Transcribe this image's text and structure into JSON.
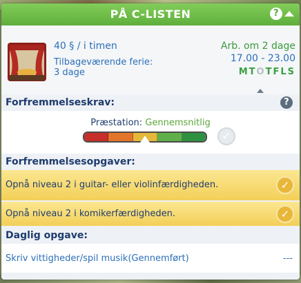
{
  "header": {
    "title": "PÅ C-LISTEN",
    "help_label": "?"
  },
  "job": {
    "icon": "stage-curtain-icon",
    "salary_amount": "40",
    "currency_symbol": "§",
    "salary_unit": "/ i timen",
    "vacation_label": "Tilbageværende ferie:",
    "vacation_value": "3 dage",
    "next_work": "Arb. om 2 dage",
    "hours": "17.00 - 23.00",
    "days": [
      {
        "letter": "M",
        "active": true
      },
      {
        "letter": "T",
        "active": true
      },
      {
        "letter": "O",
        "active": false
      },
      {
        "letter": "T",
        "active": true
      },
      {
        "letter": "F",
        "active": true
      },
      {
        "letter": "L",
        "active": true
      },
      {
        "letter": "S",
        "active": true
      }
    ]
  },
  "promotion_requirements": {
    "label": "Forfremmelseskrav:",
    "help_label": "?",
    "performance_label": "Præstation:",
    "performance_value": "Gennemsnitlig",
    "performance_level": 0.5,
    "bar_colors": [
      "#c62f2a",
      "#e3752a",
      "#e6b83a",
      "#5fb04a",
      "#2f9140"
    ],
    "check_symbol": "✓"
  },
  "promotion_tasks": {
    "label": "Forfremmelsesopgaver:",
    "items": [
      {
        "text": "Opnå niveau 2 i guitar- eller violinfærdigheden.",
        "check": "✓"
      },
      {
        "text": "Opnå niveau 2 i komikerfærdigheden.",
        "check": "✓"
      }
    ]
  },
  "daily_task": {
    "label": "Daglig opgave:",
    "text": "Skriv vittigheder/spil musik(Gennemført)",
    "status": "---"
  }
}
